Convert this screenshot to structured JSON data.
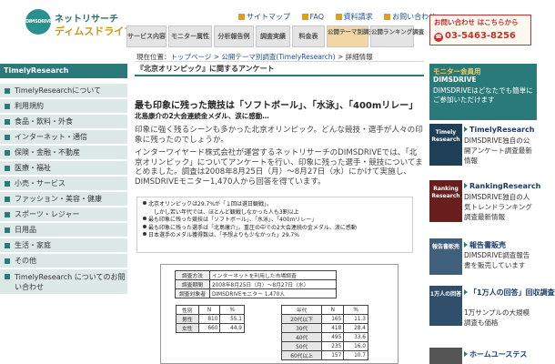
{
  "header": {
    "logo_mark": "DIMSDRIVE",
    "logo_line1": "ネットリサーチ",
    "logo_line2": "ディムスドライブ",
    "toplinks": [
      "サイトマップ",
      "FAQ",
      "資料請求",
      "お問い合わせ"
    ],
    "nav": [
      "サービス内容",
      "モニター属性",
      "分析報告例",
      "調査実績",
      "料金表",
      "公開テーマ別調査",
      "公開ランキング調査"
    ],
    "contact_label": "お問い合わせ はこちらから",
    "contact_phone": "03-5463-8256"
  },
  "breadcrumb": {
    "prefix": "現在位置：",
    "top": "トップページ",
    "sep": " > ",
    "section": "公開テーマ別調査(TimelyResearch)",
    "current": "詳細情報"
  },
  "sidebar": {
    "heading": "TimelyResearch",
    "items": [
      "TimelyResearchについて",
      "利用規約",
      "食品・飲料・外食",
      "インターネット・通信",
      "保険・金融・不動産",
      "医療・福祉",
      "小売・サービス",
      "ファッション・美容・健康",
      "スポーツ・レジャー",
      "日用品",
      "生活・家庭",
      "その他",
      "TimelyResearch についてのお問い合わせ"
    ]
  },
  "main": {
    "page_title": "『北京オリンピック』に関するアンケート",
    "headline": "最も印象に残った競技は「ソフトボール」、「水泳」、「400mリレー」",
    "subheadline": "北島康介の2大会連続金メダル、涙に感動…",
    "para1": "印象に強く残るシーンも多かった北京オリンピック。どんな競技・選手が人々の印象に残ったのでしょうか。",
    "para2": "インターワイヤード株式会社が運営するネットリサーチのDIMSDRIVEでは、「北京オリンピック」についてアンケートを行い、印象に残った選手・競技についてまとめました。調査は2008年8月25日（月）～8月27日（水）にかけて実施し、DIMSDRIVEモニター1,470人から回答を得ています。",
    "bullets": [
      "北京オリンピックは29.7%が「１回は選日観戦」。",
      "しかし若い年代では、ほとんど観戦しなかった人も3割以上",
      "最も印象に残った競技は「ソフトボール」、「水泳」、「400mリレー」",
      "最も印象に残った選手は「北島康介」。重圧の中での2大会連続の金メダル、涙に感動",
      "日本選手のメダル獲得数は、「予想よりも少なかった」29.7%"
    ]
  },
  "survey": {
    "meta": [
      {
        "k": "調査方法",
        "v": "インターネットを利用した市場調査"
      },
      {
        "k": "調査期間",
        "v": "2008年8月25日（月）～8月27日（水）"
      },
      {
        "k": "調査対象者",
        "v": "DIMSDRIVEモニター  1,470人"
      }
    ],
    "gender_header": [
      "性別",
      "N",
      "%"
    ],
    "gender": [
      {
        "label": "男性",
        "n": "810",
        "pct": "55.1"
      },
      {
        "label": "女性",
        "n": "660",
        "pct": "44.9"
      }
    ],
    "age_header": [
      "年代",
      "N",
      "%"
    ],
    "age": [
      {
        "label": "20代以下",
        "n": "165",
        "pct": "11.3"
      },
      {
        "label": "30代",
        "n": "418",
        "pct": "28.4"
      },
      {
        "label": "40代",
        "n": "495",
        "pct": "33.6"
      },
      {
        "label": "50代",
        "n": "235",
        "pct": "16.0"
      },
      {
        "label": "60代以上",
        "n": "157",
        "pct": "10.7"
      }
    ]
  },
  "right": {
    "monitor_title": "モニター会員用",
    "monitor_brand": "DIMSDRIVE",
    "monitor_desc": "DIMSDRIVEはどなたでも簡単にご参加いただけます",
    "promos": [
      {
        "thumb": "Timely Research",
        "title": "TimelyResearch",
        "desc": "DIMSDRIVE独自の公開アンケート調査最新情報"
      },
      {
        "thumb": "Ranking Research",
        "title": "RankingResearch",
        "desc": "DIMSDRIVE独自の人気トレンドランキング調査最新情報"
      },
      {
        "thumb": "報告書販売",
        "title": "報告書販売",
        "desc": "DIMSDRIVE調査報告書を販売しています"
      },
      {
        "thumb": "1万人の回答",
        "title": "「1万人の回答」回収調査",
        "desc": "1万サンプルの大規模調査も価格"
      },
      {
        "thumb": "",
        "title": "ホームユーステス",
        "desc": ""
      }
    ]
  }
}
